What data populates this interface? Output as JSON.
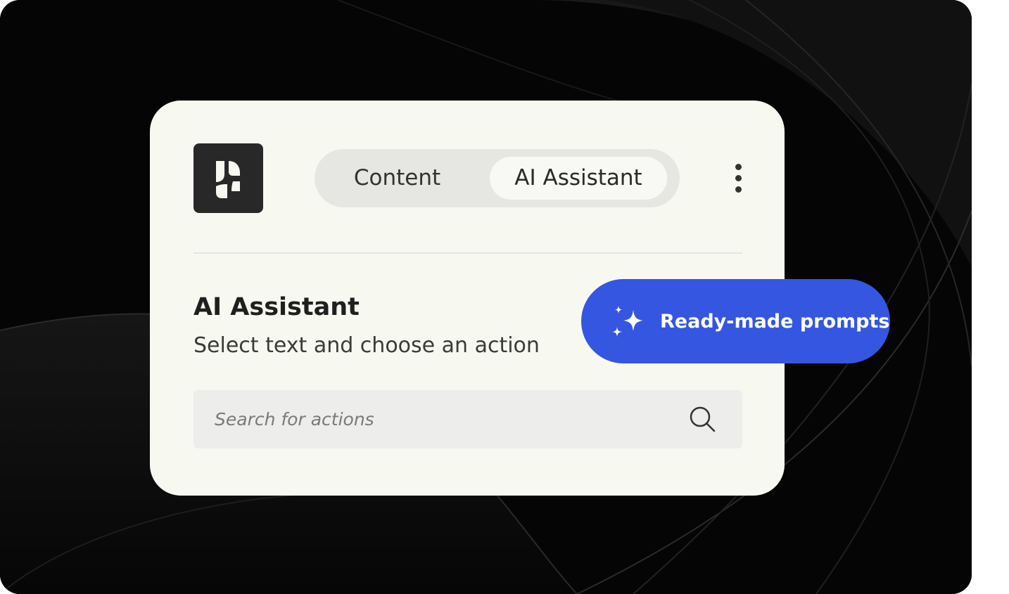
{
  "card": {
    "tabs": [
      {
        "label": "Content",
        "selected": false
      },
      {
        "label": "AI Assistant",
        "selected": true
      }
    ],
    "section_title": "AI Assistant",
    "section_subtitle": "Select text and choose an action",
    "search": {
      "value": "",
      "placeholder": "Search for actions"
    }
  },
  "prompts_button": {
    "label": "Ready-made prompts",
    "icon": "sparkles-icon"
  },
  "colors": {
    "background": "#050505",
    "card": "#f7f9f1",
    "accent": "#3556e0",
    "logo": "#282828"
  }
}
